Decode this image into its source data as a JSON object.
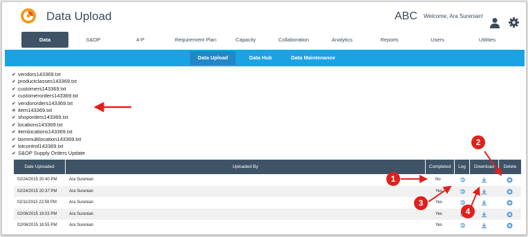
{
  "app": {
    "title": "Data Upload",
    "company": "ABC",
    "welcome": "Welcome, Ara Surenian!"
  },
  "nav": [
    "Data",
    "S&OP",
    "4-P",
    "Requirement Plan",
    "Capacity",
    "Collaboration",
    "Analytics",
    "Reports",
    "Users",
    "Utilities"
  ],
  "subnav": [
    "Data Upload",
    "Data Hub",
    "Data Maintenance"
  ],
  "files": [
    {
      "name": "vendors143369.txt",
      "status": "done"
    },
    {
      "name": "productclasses143369.txt",
      "status": "done"
    },
    {
      "name": "customers143369.txt",
      "status": "done"
    },
    {
      "name": "customerorders143369.txt",
      "status": "done"
    },
    {
      "name": "vendororders143369.txt",
      "status": "done"
    },
    {
      "name": "item143369.txt",
      "status": "loading"
    },
    {
      "name": "shoporders143369.txt",
      "status": "done"
    },
    {
      "name": "locations143369.txt",
      "status": "done"
    },
    {
      "name": "itemlocations143369.txt",
      "status": "done"
    },
    {
      "name": "bommultilocation143369.txt",
      "status": "done"
    },
    {
      "name": "lotcontrol143369.txt",
      "status": "done"
    },
    {
      "name": "S&OP Supply Orders Update",
      "status": "done"
    }
  ],
  "table": {
    "headers": [
      "Date Uploaded",
      "Uploaded By",
      "Completed",
      "Log",
      "Download",
      "Delete"
    ],
    "rows": [
      {
        "date": "02/24/2015 20:40 PM",
        "by": "Ara Surenian",
        "completed": "No"
      },
      {
        "date": "02/24/2015 20:37 PM",
        "by": "Ara Surenian",
        "completed": "Yes"
      },
      {
        "date": "02/11/2015 22:59 PM",
        "by": "Ara Surenian",
        "completed": "Yes"
      },
      {
        "date": "02/06/2015 19:03 PM",
        "by": "Ara Surenian",
        "completed": "Yes"
      },
      {
        "date": "02/06/2015 18:55 PM",
        "by": "Ara Surenian",
        "completed": "Yes"
      }
    ]
  },
  "callouts": [
    "1",
    "2",
    "3",
    "4"
  ],
  "colors": {
    "accent": "#1aa3e3",
    "header": "#3e5366",
    "annotation": "#e0201c",
    "icon": "#5b9bd5"
  }
}
